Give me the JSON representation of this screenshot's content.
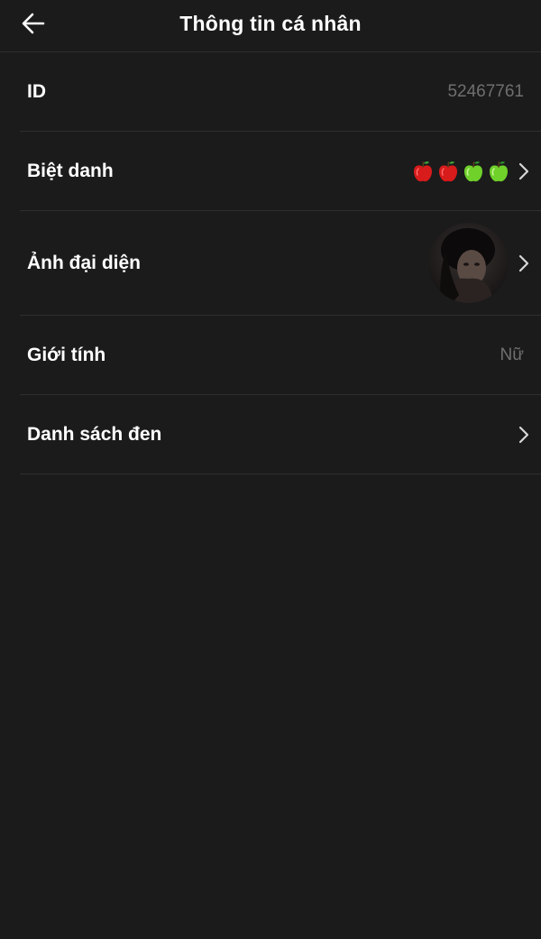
{
  "header": {
    "title": "Thông tin cá nhân",
    "back_icon": "arrow-left-icon"
  },
  "rows": {
    "id": {
      "label": "ID",
      "value": "52467761"
    },
    "nickname": {
      "label": "Biệt danh",
      "value_icons": [
        "red-apple-icon",
        "red-apple-icon",
        "green-apple-icon",
        "green-apple-icon"
      ]
    },
    "avatar": {
      "label": "Ảnh đại diện",
      "icon": "avatar-image"
    },
    "gender": {
      "label": "Giới tính",
      "value": "Nữ"
    },
    "blacklist": {
      "label": "Danh sách đen"
    }
  },
  "colors": {
    "background": "#1b1b1b",
    "divider": "#2e2e2e",
    "label": "#ffffff",
    "value": "#6f6f6f",
    "red_apple": "#d81b1b",
    "green_apple": "#6fd12a"
  }
}
